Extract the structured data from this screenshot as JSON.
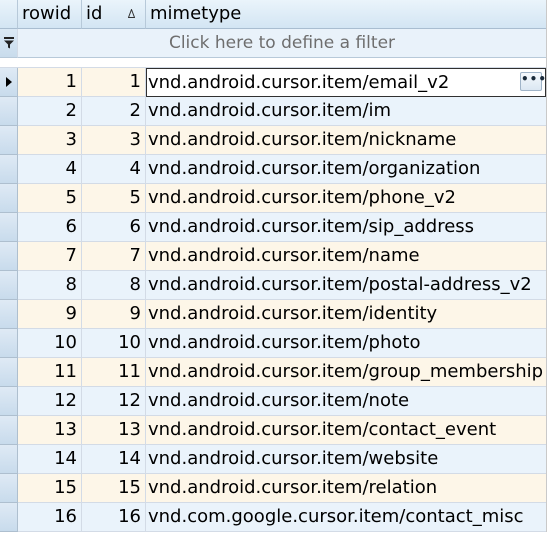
{
  "grid": {
    "columns": [
      {
        "key": "rowid",
        "label": "rowid"
      },
      {
        "key": "id",
        "label": "id"
      },
      {
        "key": "mimetype",
        "label": "mimetype"
      }
    ],
    "filter_placeholder": "Click here to define a filter",
    "sorted_column": "id",
    "current_row": 1,
    "rows": [
      {
        "rowid": "1",
        "id": "1",
        "mimetype": "vnd.android.cursor.item/email_v2"
      },
      {
        "rowid": "2",
        "id": "2",
        "mimetype": "vnd.android.cursor.item/im"
      },
      {
        "rowid": "3",
        "id": "3",
        "mimetype": "vnd.android.cursor.item/nickname"
      },
      {
        "rowid": "4",
        "id": "4",
        "mimetype": "vnd.android.cursor.item/organization"
      },
      {
        "rowid": "5",
        "id": "5",
        "mimetype": "vnd.android.cursor.item/phone_v2"
      },
      {
        "rowid": "6",
        "id": "6",
        "mimetype": "vnd.android.cursor.item/sip_address"
      },
      {
        "rowid": "7",
        "id": "7",
        "mimetype": "vnd.android.cursor.item/name"
      },
      {
        "rowid": "8",
        "id": "8",
        "mimetype": "vnd.android.cursor.item/postal-address_v2"
      },
      {
        "rowid": "9",
        "id": "9",
        "mimetype": "vnd.android.cursor.item/identity"
      },
      {
        "rowid": "10",
        "id": "10",
        "mimetype": "vnd.android.cursor.item/photo"
      },
      {
        "rowid": "11",
        "id": "11",
        "mimetype": "vnd.android.cursor.item/group_membership"
      },
      {
        "rowid": "12",
        "id": "12",
        "mimetype": "vnd.android.cursor.item/note"
      },
      {
        "rowid": "13",
        "id": "13",
        "mimetype": "vnd.android.cursor.item/contact_event"
      },
      {
        "rowid": "14",
        "id": "14",
        "mimetype": "vnd.android.cursor.item/website"
      },
      {
        "rowid": "15",
        "id": "15",
        "mimetype": "vnd.android.cursor.item/relation"
      },
      {
        "rowid": "16",
        "id": "16",
        "mimetype": "vnd.com.google.cursor.item/contact_misc"
      }
    ],
    "ellipsis_label": "•••",
    "colors": {
      "odd_row": "#fdf6e8",
      "even_row": "#eaf3fb",
      "header": "#d3e5f3",
      "filter_row": "#e9f2fa"
    }
  }
}
